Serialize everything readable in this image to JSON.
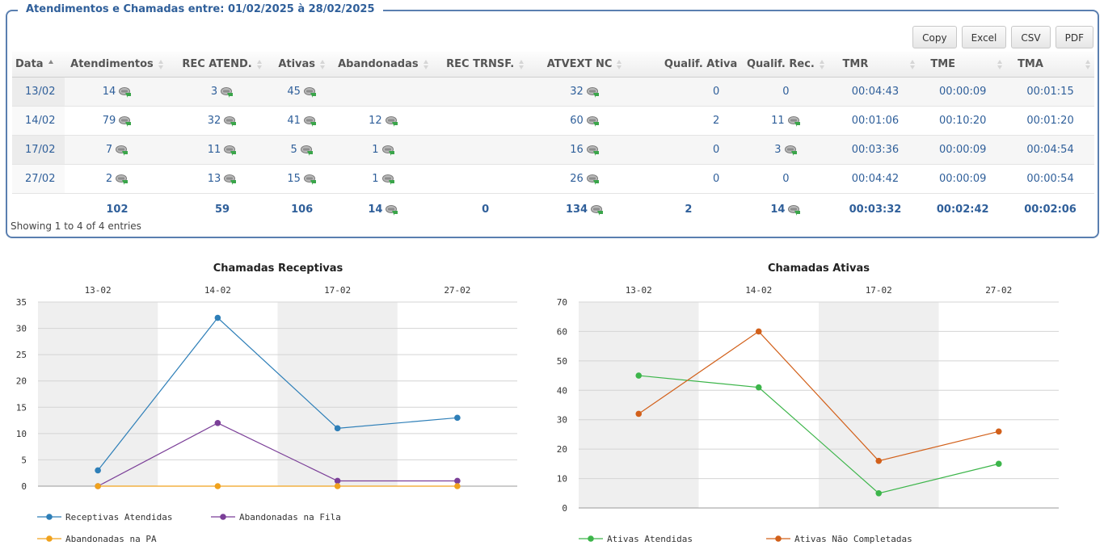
{
  "panel": {
    "legend": "Atendimentos e Chamadas entre: 01/02/2025 à 28/02/2025",
    "buttons": {
      "copy": "Copy",
      "excel": "Excel",
      "csv": "CSV",
      "pdf": "PDF"
    },
    "info": "Showing 1 to 4 of 4 entries"
  },
  "table": {
    "headers": [
      "Data",
      "Atendimentos",
      "REC ATEND.",
      "Ativas",
      "Abandonadas",
      "REC TRNSF.",
      "ATVEXT NC",
      "Qualif. Ativa",
      "Qualif. Rec.",
      "TMR",
      "TME",
      "TMA"
    ],
    "rows": [
      {
        "data": "13/02",
        "atendimentos": "14",
        "rec_atend": "3",
        "ativas": "45",
        "abandonadas": "",
        "rec_trnsf": "",
        "atvext_nc": "32",
        "qualif_ativa": "0",
        "qualif_rec": "0",
        "tmr": "00:04:43",
        "tme": "00:00:09",
        "tma": "00:01:15"
      },
      {
        "data": "14/02",
        "atendimentos": "79",
        "rec_atend": "32",
        "ativas": "41",
        "abandonadas": "12",
        "rec_trnsf": "",
        "atvext_nc": "60",
        "qualif_ativa": "2",
        "qualif_rec": "11",
        "tmr": "00:01:06",
        "tme": "00:10:20",
        "tma": "00:01:20"
      },
      {
        "data": "17/02",
        "atendimentos": "7",
        "rec_atend": "11",
        "ativas": "5",
        "abandonadas": "1",
        "rec_trnsf": "",
        "atvext_nc": "16",
        "qualif_ativa": "0",
        "qualif_rec": "3",
        "tmr": "00:03:36",
        "tme": "00:00:09",
        "tma": "00:04:54"
      },
      {
        "data": "27/02",
        "atendimentos": "2",
        "rec_atend": "13",
        "ativas": "15",
        "abandonadas": "1",
        "rec_trnsf": "",
        "atvext_nc": "26",
        "qualif_ativa": "0",
        "qualif_rec": "0",
        "tmr": "00:04:42",
        "tme": "00:00:09",
        "tma": "00:00:54"
      }
    ],
    "totals": {
      "atendimentos": "102",
      "rec_atend": "59",
      "ativas": "106",
      "abandonadas": "14",
      "rec_trnsf": "0",
      "atvext_nc": "134",
      "qualif_ativa": "2",
      "qualif_rec": "14",
      "tmr": "00:03:32",
      "tme": "00:02:42",
      "tma": "00:02:06"
    },
    "link_icon": "phone-detail-icon"
  },
  "chart_data": [
    {
      "type": "line",
      "title": "Chamadas Receptivas",
      "categories": [
        "13-02",
        "14-02",
        "17-02",
        "27-02"
      ],
      "ylim": [
        0,
        35
      ],
      "yticks": [
        0,
        5,
        10,
        15,
        20,
        25,
        30,
        35
      ],
      "grid": true,
      "legend_position": "bottom",
      "series": [
        {
          "name": "Receptivas Atendidas",
          "values": [
            3,
            32,
            11,
            13
          ],
          "color": "#2e7fb8"
        },
        {
          "name": "Abandonadas na Fila",
          "values": [
            0,
            12,
            1,
            1
          ],
          "color": "#7b3f98"
        },
        {
          "name": "Abandonadas na PA",
          "values": [
            0,
            0,
            0,
            0
          ],
          "color": "#f0a21d"
        }
      ]
    },
    {
      "type": "line",
      "title": "Chamadas Ativas",
      "categories": [
        "13-02",
        "14-02",
        "17-02",
        "27-02"
      ],
      "ylim": [
        0,
        70
      ],
      "yticks": [
        0,
        10,
        20,
        30,
        40,
        50,
        60,
        70
      ],
      "grid": true,
      "legend_position": "bottom",
      "series": [
        {
          "name": "Ativas Atendidas",
          "values": [
            45,
            41,
            5,
            15
          ],
          "color": "#3cb54a"
        },
        {
          "name": "Ativas Não Completadas",
          "values": [
            32,
            60,
            16,
            26
          ],
          "color": "#d2601a"
        }
      ]
    }
  ]
}
